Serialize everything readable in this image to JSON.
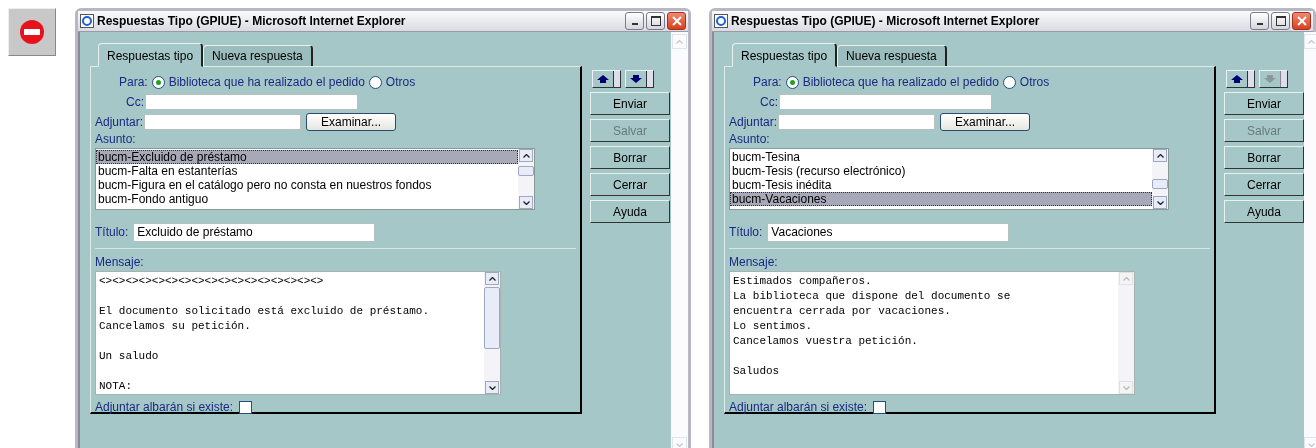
{
  "windows": [
    {
      "title": "Respuestas Tipo (GPIUE) - Microsoft Internet Explorer",
      "tabs": [
        {
          "label": "Respuestas tipo",
          "selected": true
        },
        {
          "label": "Nueva respuesta",
          "selected": false
        }
      ],
      "para": {
        "label": "Para:",
        "options": [
          {
            "label": "Biblioteca que ha realizado el pedido",
            "selected": true
          },
          {
            "label": "Otros",
            "selected": false
          }
        ]
      },
      "cc": {
        "label": "Cc:"
      },
      "adjuntar": {
        "label": "Adjuntar:",
        "button": "Examinar..."
      },
      "asunto": {
        "label": "Asunto:",
        "items": [
          {
            "text": "bucm-Excluido de préstamo",
            "selected": true
          },
          {
            "text": "bucm-Falta en estanterías",
            "selected": false
          },
          {
            "text": "bucm-Figura en el catálogo pero no consta en nuestros fondos",
            "selected": false
          },
          {
            "text": "bucm-Fondo antiguo",
            "selected": false
          }
        ]
      },
      "titulo": {
        "label": "Título:",
        "value": "Excluido de préstamo"
      },
      "mensaje": {
        "label": "Mensaje:",
        "text": "<><><><><><><><><><><><><><><><><>\n\nEl documento solicitado está excluido de préstamo.\nCancelamos su petición.\n\nUn saludo\n\nNOTA:",
        "scrollable": true
      },
      "albaran": {
        "label": "Adjuntar albarán si existe:",
        "checked": false
      },
      "nav": [
        {
          "kind": "up",
          "disabled": false
        },
        {
          "kind": "down",
          "disabled": false
        }
      ],
      "buttons": [
        {
          "label": "Enviar",
          "disabled": false
        },
        {
          "label": "Salvar",
          "disabled": true
        },
        {
          "label": "Borrar",
          "disabled": false
        },
        {
          "label": "Cerrar",
          "disabled": false
        },
        {
          "label": "Ayuda",
          "disabled": false
        }
      ]
    },
    {
      "title": "Respuestas Tipo (GPIUE) - Microsoft Internet Explorer",
      "tabs": [
        {
          "label": "Respuestas tipo",
          "selected": true
        },
        {
          "label": "Nueva respuesta",
          "selected": false
        }
      ],
      "para": {
        "label": "Para:",
        "options": [
          {
            "label": "Biblioteca que ha realizado el pedido",
            "selected": true
          },
          {
            "label": "Otros",
            "selected": false
          }
        ]
      },
      "cc": {
        "label": "Cc:"
      },
      "adjuntar": {
        "label": "Adjuntar:",
        "button": "Examinar..."
      },
      "asunto": {
        "label": "Asunto:",
        "items": [
          {
            "text": "bucm-Tesina",
            "selected": false
          },
          {
            "text": "bucm-Tesis (recurso electrónico)",
            "selected": false
          },
          {
            "text": "bucm-Tesis inédita",
            "selected": false
          },
          {
            "text": "bucm-Vacaciones",
            "selected": true
          }
        ]
      },
      "titulo": {
        "label": "Título:",
        "value": "Vacaciones"
      },
      "mensaje": {
        "label": "Mensaje:",
        "text": "Estimados compañeros.\nLa biblioteca que dispone del documento se\nencuentra cerrada por vacaciones.\nLo sentimos.\nCancelamos vuestra petición.\n\nSaludos",
        "scrollable": false
      },
      "albaran": {
        "label": "Adjuntar albarán si existe:",
        "checked": false
      },
      "nav": [
        {
          "kind": "up",
          "disabled": false
        },
        {
          "kind": "down",
          "disabled": true
        }
      ],
      "buttons": [
        {
          "label": "Enviar",
          "disabled": false
        },
        {
          "label": "Salvar",
          "disabled": true
        },
        {
          "label": "Borrar",
          "disabled": false
        },
        {
          "label": "Cerrar",
          "disabled": false
        },
        {
          "label": "Ayuda",
          "disabled": false
        }
      ]
    }
  ]
}
